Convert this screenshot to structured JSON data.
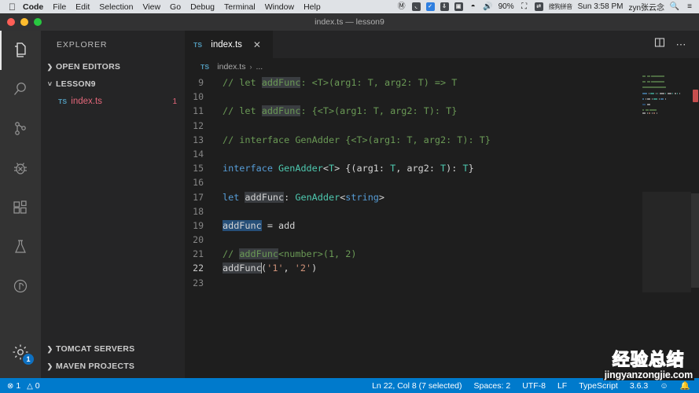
{
  "macbar": {
    "apple_icon": "apple-logo-icon",
    "menus": [
      {
        "label": "Code",
        "bold": true
      },
      {
        "label": "File",
        "bold": false
      },
      {
        "label": "Edit",
        "bold": false
      },
      {
        "label": "Selection",
        "bold": false
      },
      {
        "label": "View",
        "bold": false
      },
      {
        "label": "Go",
        "bold": false
      },
      {
        "label": "Debug",
        "bold": false
      },
      {
        "label": "Terminal",
        "bold": false
      },
      {
        "label": "Window",
        "bold": false
      },
      {
        "label": "Help",
        "bold": false
      }
    ],
    "status": {
      "battery_percent": "90%",
      "clock": "Sun 3:58 PM",
      "user": "zyn张云念",
      "ime_label": "搜狗拼音",
      "icons": [
        "record-icon",
        "dnd-icon",
        "checkbox-icon",
        "download-icon",
        "app-icon",
        "wifi-icon",
        "volume-icon",
        "battery-icon",
        "sync-icon",
        "search-icon",
        "control-center-icon"
      ]
    }
  },
  "window": {
    "title": "index.ts — lesson9"
  },
  "activitybar": {
    "items": [
      {
        "name": "explorer",
        "icon": "files-icon",
        "active": true,
        "badge": null
      },
      {
        "name": "search",
        "icon": "search-icon",
        "active": false,
        "badge": null
      },
      {
        "name": "source-control",
        "icon": "source-control-icon",
        "active": false,
        "badge": null
      },
      {
        "name": "debug",
        "icon": "debug-bug-icon",
        "active": false,
        "badge": null
      },
      {
        "name": "extensions",
        "icon": "extensions-icon",
        "active": false,
        "badge": null
      },
      {
        "name": "test",
        "icon": "test-flask-icon",
        "active": false,
        "badge": null
      },
      {
        "name": "maven",
        "icon": "maven-circle-icon",
        "active": false,
        "badge": null
      }
    ],
    "settings": {
      "name": "manage",
      "icon": "gear-icon",
      "badge": "1"
    }
  },
  "sidebar": {
    "title": "EXPLORER",
    "sections": [
      {
        "label": "OPEN EDITORS",
        "expanded": false,
        "chevron": "chevron-right-icon"
      },
      {
        "label": "LESSON9",
        "expanded": true,
        "chevron": "chevron-down-icon"
      }
    ],
    "file": {
      "ts_label": "TS",
      "name": "index.ts",
      "problem_count": "1"
    },
    "bottom_sections": [
      {
        "label": "TOMCAT SERVERS",
        "expanded": false,
        "chevron": "chevron-right-icon"
      },
      {
        "label": "MAVEN PROJECTS",
        "expanded": false,
        "chevron": "chevron-right-icon"
      }
    ]
  },
  "editor": {
    "tab": {
      "ts_label": "TS",
      "name": "index.ts",
      "close_icon": "close-icon"
    },
    "actions": [
      {
        "name": "split-editor",
        "icon": "split-editor-icon"
      },
      {
        "name": "more-actions",
        "icon": "ellipsis-icon"
      }
    ],
    "breadcrumbs": {
      "ts_label": "TS",
      "file": "index.ts",
      "separator": "›",
      "more": "..."
    },
    "first_visible_line": 9,
    "lines": [
      {
        "n": 9,
        "tokens": [
          {
            "t": "// let ",
            "c": "cmt"
          },
          {
            "t": "addFunc",
            "c": "cmt hl-cmt"
          },
          {
            "t": ": <T>(arg1: T, arg2: T) => T",
            "c": "cmt"
          }
        ]
      },
      {
        "n": 10,
        "tokens": []
      },
      {
        "n": 11,
        "tokens": [
          {
            "t": "// let ",
            "c": "cmt"
          },
          {
            "t": "addFunc",
            "c": "cmt hl-cmt"
          },
          {
            "t": ": {<T>(arg1: T, arg2: T): T}",
            "c": "cmt"
          }
        ]
      },
      {
        "n": 12,
        "tokens": []
      },
      {
        "n": 13,
        "tokens": [
          {
            "t": "// interface GenAdder {<T>(arg1: T, arg2: T): T}",
            "c": "cmt"
          }
        ]
      },
      {
        "n": 14,
        "tokens": []
      },
      {
        "n": 15,
        "tokens": [
          {
            "t": "interface",
            "c": "kw"
          },
          {
            "t": " ",
            "c": "pl"
          },
          {
            "t": "GenAdder",
            "c": "typ"
          },
          {
            "t": "<",
            "c": "pl"
          },
          {
            "t": "T",
            "c": "typ"
          },
          {
            "t": "> {(arg1: ",
            "c": "pl"
          },
          {
            "t": "T",
            "c": "typ"
          },
          {
            "t": ", arg2: ",
            "c": "pl"
          },
          {
            "t": "T",
            "c": "typ"
          },
          {
            "t": "): ",
            "c": "pl"
          },
          {
            "t": "T",
            "c": "typ"
          },
          {
            "t": "}",
            "c": "pl"
          }
        ]
      },
      {
        "n": 16,
        "tokens": []
      },
      {
        "n": 17,
        "tokens": [
          {
            "t": "let",
            "c": "kw"
          },
          {
            "t": " ",
            "c": "pl"
          },
          {
            "t": "addFunc",
            "c": "pl hl"
          },
          {
            "t": ": ",
            "c": "pl"
          },
          {
            "t": "GenAdder",
            "c": "typ"
          },
          {
            "t": "<",
            "c": "pl"
          },
          {
            "t": "string",
            "c": "kw"
          },
          {
            "t": ">",
            "c": "pl"
          }
        ]
      },
      {
        "n": 18,
        "tokens": []
      },
      {
        "n": 19,
        "tokens": [
          {
            "t": "addFunc",
            "c": "sel"
          },
          {
            "t": " = add",
            "c": "pl"
          }
        ]
      },
      {
        "n": 20,
        "tokens": []
      },
      {
        "n": 21,
        "tokens": [
          {
            "t": "// ",
            "c": "cmt"
          },
          {
            "t": "addFunc",
            "c": "cmt hl-cmt"
          },
          {
            "t": "<number>(1, 2)",
            "c": "cmt"
          }
        ]
      },
      {
        "n": 22,
        "tokens": [
          {
            "t": "addFunc",
            "c": "pl hl"
          },
          {
            "t": "(",
            "c": "pl"
          },
          {
            "t": "'1'",
            "c": "str"
          },
          {
            "t": ", ",
            "c": "pl"
          },
          {
            "t": "'2'",
            "c": "str"
          },
          {
            "t": ")",
            "c": "pl"
          }
        ],
        "current": true,
        "caret_after_token": 0
      },
      {
        "n": 23,
        "tokens": []
      }
    ]
  },
  "statusbar": {
    "left": [
      {
        "name": "error-count",
        "icon": "error-circle-icon",
        "value": "1"
      },
      {
        "name": "warning-count",
        "icon": "warning-triangle-icon",
        "value": "0"
      }
    ],
    "right": [
      {
        "name": "cursor-position",
        "label": "Ln 22, Col 8 (7 selected)"
      },
      {
        "name": "indentation",
        "label": "Spaces: 2"
      },
      {
        "name": "encoding",
        "label": "UTF-8"
      },
      {
        "name": "line-endings",
        "label": "LF"
      },
      {
        "name": "language-mode",
        "label": "TypeScript"
      },
      {
        "name": "ts-version",
        "label": "3.6.3"
      },
      {
        "name": "feedback",
        "label": "☺"
      },
      {
        "name": "notifications",
        "label": "🔔"
      }
    ]
  },
  "watermark": {
    "cn": "经验总结",
    "en": "jingyanzongjie.com"
  },
  "colors": {
    "accent_statusbar": "#007acc",
    "editor_bg": "#1e1e1e",
    "sidebar_bg": "#252526",
    "activitybar_bg": "#333333",
    "titlebar_bg": "#323233",
    "keyword": "#569cd6",
    "type": "#4ec9b0",
    "comment": "#6a9955",
    "string": "#ce9178",
    "error": "#e4677a",
    "selection": "#264f78",
    "word_highlight": "#3a3d41"
  }
}
